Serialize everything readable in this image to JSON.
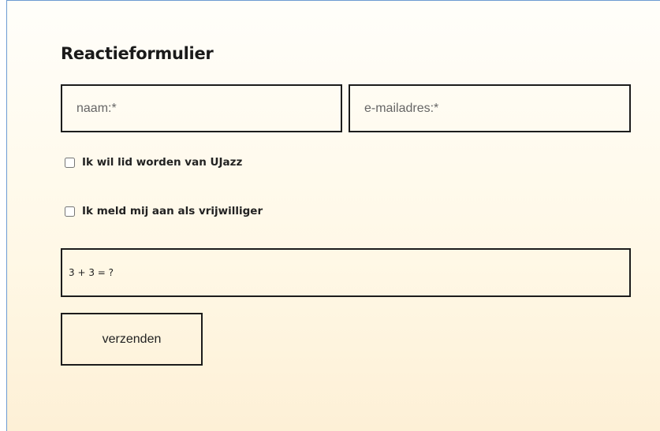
{
  "form": {
    "title": "Reactieformulier",
    "naam_placeholder": "naam:*",
    "email_placeholder": "e-mailadres:*",
    "checkbox_lid_label": "Ik wil lid worden van UJazz",
    "checkbox_vrijwilliger_label": "Ik meld mij aan als vrijwilliger",
    "captcha_placeholder": "3 + 3 = ?",
    "submit_label": "verzenden"
  }
}
